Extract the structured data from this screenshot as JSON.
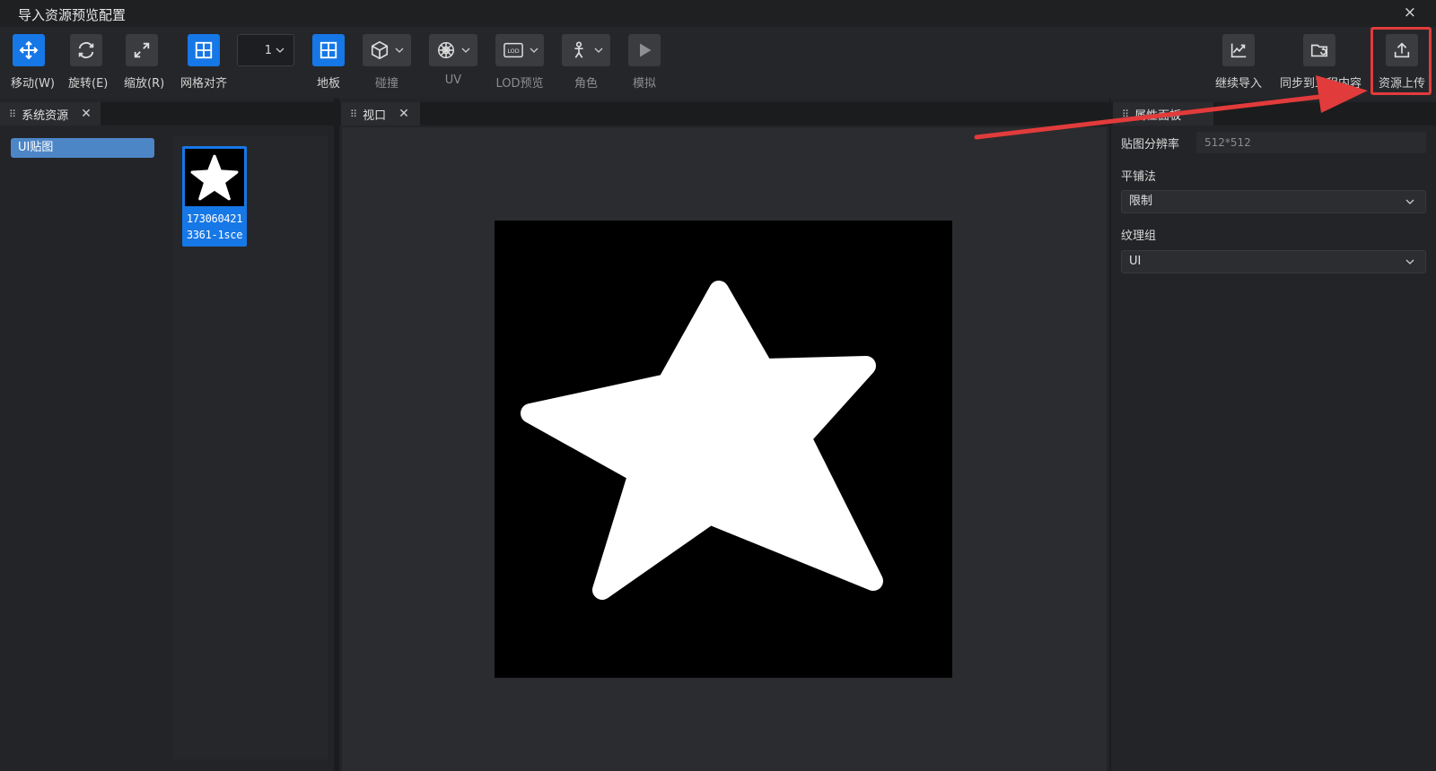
{
  "window": {
    "title": "导入资源预览配置",
    "close_glyph": "×"
  },
  "toolbar": {
    "move_label": "移动(W)",
    "rotate_label": "旋转(E)",
    "scale_label": "缩放(R)",
    "grid_snap_label": "网格对齐",
    "grid_value": "1",
    "floor_label": "地板",
    "collision_label": "碰撞",
    "uv_label": "UV",
    "lod_label": "LOD预览",
    "character_label": "角色",
    "simulate_label": "模拟",
    "continue_import_label": "继续导入",
    "sync_label": "同步到工程内容",
    "upload_label": "资源上传",
    "lod_badge": "LOD"
  },
  "panels": {
    "system_assets": {
      "tab": "系统资源",
      "category": "UI贴图",
      "asset_name_line1": "173060421",
      "asset_name_line2": "3361-1sce"
    },
    "viewport": {
      "tab": "视口"
    },
    "properties": {
      "tab": "属性面板",
      "resolution_label": "贴图分辨率",
      "resolution_value": "512*512",
      "tiling_label": "平铺法",
      "tiling_value": "限制",
      "texture_group_label": "纹理组",
      "texture_group_value": "UI"
    }
  },
  "colors": {
    "accent": "#1677e6",
    "annotation": "#e23b3b"
  }
}
